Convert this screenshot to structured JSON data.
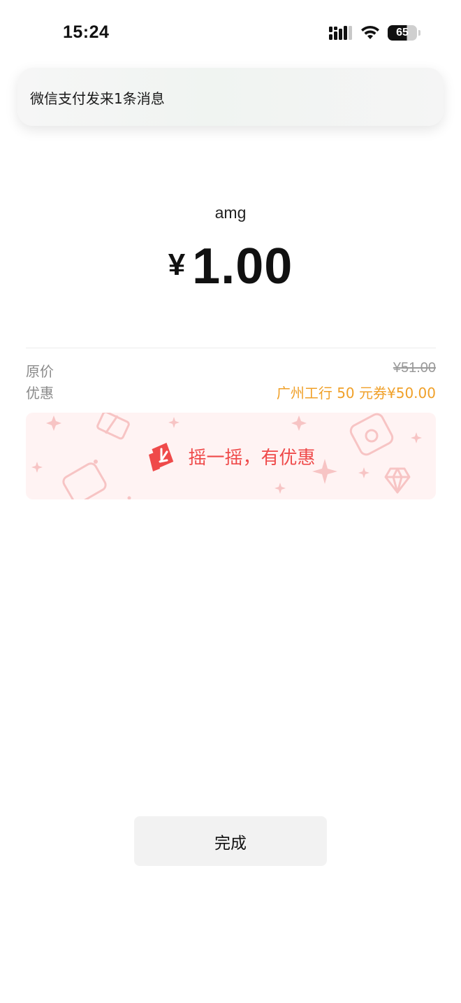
{
  "status_bar": {
    "time": "15:24",
    "battery": "65",
    "icons": [
      "signal-icon",
      "wifi-icon",
      "battery-icon"
    ]
  },
  "notification": {
    "text": "微信支付发来1条消息"
  },
  "payment": {
    "payee": "amg",
    "currency": "¥",
    "amount": "1.00"
  },
  "details": {
    "original_label": "原价",
    "original_value": "¥51.00",
    "discount_label": "优惠",
    "discount_value": "广州工行 50 元券¥50.00"
  },
  "shake": {
    "text": "摇一摇，有优惠",
    "icon": "coupon-shake-icon",
    "accent_color": "#ef4a4a",
    "background_color": "#fff3f3"
  },
  "footer": {
    "done_label": "完成"
  },
  "colors": {
    "discount": "#f0a028",
    "muted": "#8a8a8a"
  }
}
